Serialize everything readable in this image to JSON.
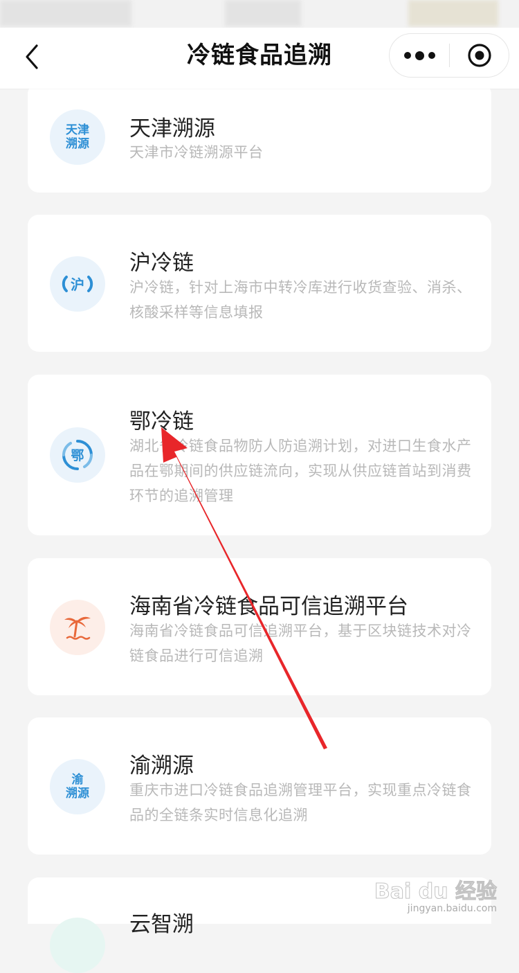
{
  "nav": {
    "title": "冷链食品追溯",
    "back_icon": "chevron-left-icon",
    "more_icon": "more-dots-icon",
    "close_icon": "target-close-icon"
  },
  "items": [
    {
      "icon_text": [
        "天津",
        "溯源"
      ],
      "title": "天津溯源",
      "desc": "天津市冷链溯源平台"
    },
    {
      "icon_text": [
        "沪"
      ],
      "title": "沪冷链",
      "desc": "沪冷链，针对上海市中转冷库进行收货查验、消杀、核酸采样等信息填报"
    },
    {
      "icon_text": [
        "鄂"
      ],
      "title": "鄂冷链",
      "desc": "湖北省冷链食品物防人防追溯计划，对进口生食水产品在鄂期间的供应链流向，实现从供应链首站到消费环节的追溯管理"
    },
    {
      "icon_text": [],
      "icon_name": "palm-tree-icon",
      "title": "海南省冷链食品可信追溯平台",
      "desc": "海南省冷链食品可信追溯平台，基于区块链技术对冷链食品进行可信追溯"
    },
    {
      "icon_text": [
        "渝",
        "溯源"
      ],
      "title": "渝溯源",
      "desc": "重庆市进口冷链食品追溯管理平台，实现重点冷链食品的全链条实时信息化追溯"
    },
    {
      "title": "云智溯"
    }
  ],
  "watermark": {
    "main": "Bai du 经验",
    "sub": "jingyan.baidu.com"
  },
  "colors": {
    "accent_blue": "#2d8fd5",
    "accent_orange": "#e8683a",
    "arrow_red": "#e8262a"
  }
}
